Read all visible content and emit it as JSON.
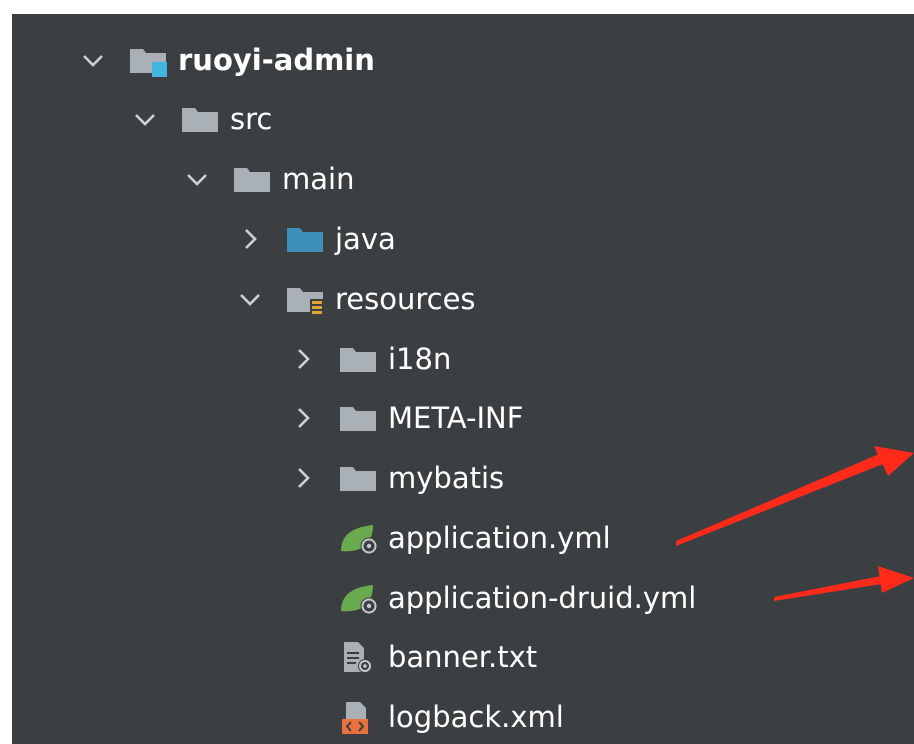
{
  "tree": {
    "items": [
      {
        "label": "ruoyi-admin",
        "expanded": true,
        "icon": "module-folder-icon"
      },
      {
        "label": "src",
        "expanded": true,
        "icon": "folder-icon"
      },
      {
        "label": "main",
        "expanded": true,
        "icon": "folder-icon"
      },
      {
        "label": "java",
        "expanded": false,
        "icon": "source-folder-icon"
      },
      {
        "label": "resources",
        "expanded": true,
        "icon": "resources-folder-icon"
      },
      {
        "label": "i18n",
        "expanded": false,
        "icon": "folder-icon"
      },
      {
        "label": "META-INF",
        "expanded": false,
        "icon": "folder-icon"
      },
      {
        "label": "mybatis",
        "expanded": false,
        "icon": "folder-icon"
      },
      {
        "label": "application.yml",
        "icon": "spring-config-icon"
      },
      {
        "label": "application-druid.yml",
        "icon": "spring-config-icon"
      },
      {
        "label": "banner.txt",
        "icon": "text-file-icon"
      },
      {
        "label": "logback.xml",
        "icon": "xml-file-icon"
      }
    ]
  },
  "colors": {
    "panel_bg": "#3c3f41",
    "text": "#ffffff",
    "folder": "#a9b0b6",
    "source_folder": "#3d8eb9",
    "module_badge": "#40b6e0",
    "spring_leaf": "#6aaa4f",
    "xml_badge": "#e8713c",
    "annotation_arrow": "#ff2a1a"
  }
}
